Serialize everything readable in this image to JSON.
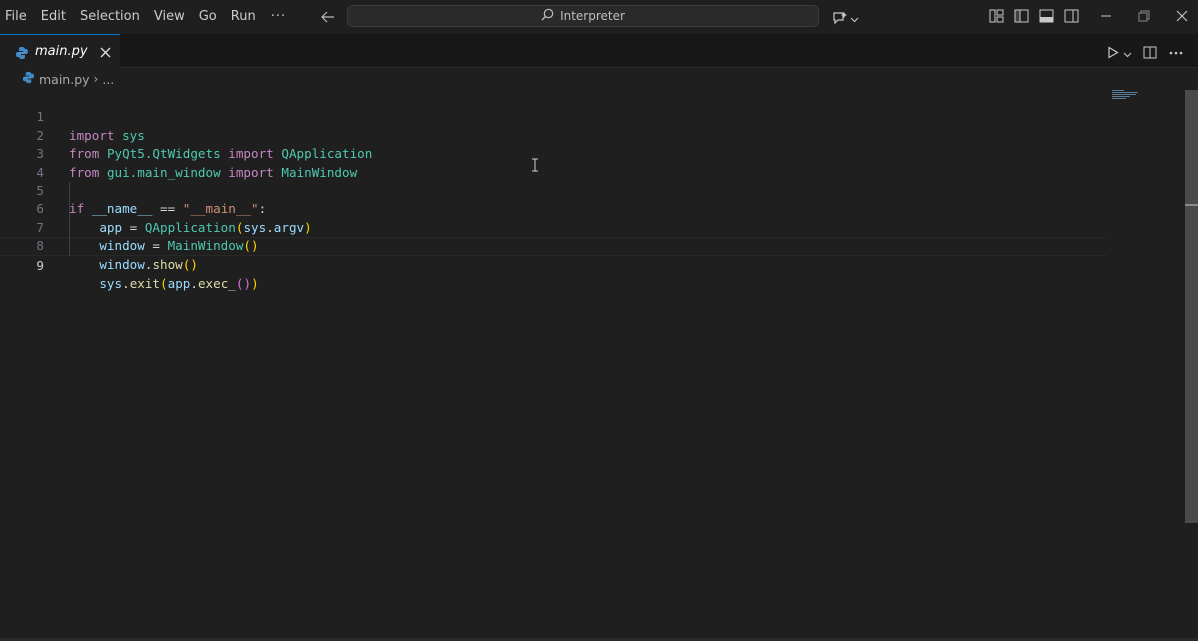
{
  "menu": {
    "items": [
      "File",
      "Edit",
      "Selection",
      "View",
      "Go",
      "Run"
    ],
    "more": "···"
  },
  "command_center": {
    "text": "Interpreter"
  },
  "tab": {
    "label": "main.py"
  },
  "breadcrumb": {
    "file": "main.py",
    "sep": "›",
    "rest": "..."
  },
  "editor": {
    "line_numbers": [
      "1",
      "2",
      "3",
      "4",
      "5",
      "6",
      "7",
      "8",
      "9"
    ],
    "active_line": 9
  },
  "colors": {
    "accent": "#0078d4",
    "keyword": "#c586c0",
    "class": "#4ec9b0",
    "variable": "#9cdcfe",
    "function": "#dcdcaa",
    "string": "#ce9178",
    "bracket": "#ffd700"
  },
  "icons": {
    "search": "search-icon",
    "python": "python-file-icon",
    "close": "close-icon",
    "run": "run-icon"
  },
  "code": {
    "l1": {
      "a": "import",
      "b": " ",
      "c": "sys"
    },
    "l2": {
      "a": "from",
      "b": " ",
      "c": "PyQt5.QtWidgets",
      "d": " ",
      "e": "import",
      "f": " ",
      "g": "QApplication"
    },
    "l3": {
      "a": "from",
      "b": " ",
      "c": "gui.main_window",
      "d": " ",
      "e": "import",
      "f": " ",
      "g": "MainWindow"
    },
    "l5": {
      "a": "if",
      "b": " ",
      "c": "__name__",
      "d": " == ",
      "e": "\"__main__\"",
      "f": ":"
    },
    "l6": {
      "i": "    ",
      "a": "app",
      "b": " = ",
      "c": "QApplication",
      "d": "(",
      "e": "sys",
      "f": ".",
      "g": "argv",
      "h": ")"
    },
    "l7": {
      "i": "    ",
      "a": "window",
      "b": " = ",
      "c": "MainWindow",
      "d": "()"
    },
    "l8": {
      "i": "    ",
      "a": "window",
      "b": ".",
      "c": "show",
      "d": "()"
    },
    "l9": {
      "i": "    ",
      "a": "sys",
      "b": ".",
      "c": "exit",
      "d": "(",
      "e": "app",
      "f": ".",
      "g": "exec_",
      "h": "()",
      "j": ")"
    }
  }
}
